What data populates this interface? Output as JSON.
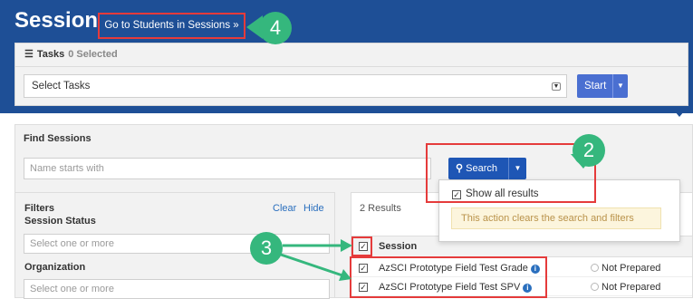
{
  "header": {
    "title": "Sessions",
    "goto_link": "Go to Students in Sessions »"
  },
  "tasks": {
    "label": "Tasks",
    "selected": "0 Selected",
    "select_value": "Select Tasks",
    "start_label": "Start"
  },
  "find": {
    "title": "Find Sessions",
    "name_placeholder": "Name starts with",
    "search_label": "Search",
    "menu": {
      "show_all": "Show all results",
      "note": "This action clears the search and filters"
    }
  },
  "filters": {
    "title": "Filters",
    "clear": "Clear",
    "hide": "Hide",
    "session_status_label": "Session Status",
    "session_status_placeholder": "Select one or more",
    "organization_label": "Organization",
    "organization_placeholder": "Select one or more"
  },
  "results": {
    "count": "2 Results",
    "col_session": "Session",
    "rows": [
      {
        "name": "AzSCI Prototype Field Test Grade",
        "status": "Not Prepared"
      },
      {
        "name": "AzSCI Prototype Field Test SPV",
        "status": "Not Prepared"
      }
    ]
  },
  "callouts": {
    "step2": "2",
    "step3": "3",
    "step4": "4"
  },
  "colors": {
    "header_blue": "#1e4f96",
    "callout_green": "#35b77d",
    "highlight_red": "#e53b3b",
    "link_blue": "#2a6fbe"
  }
}
